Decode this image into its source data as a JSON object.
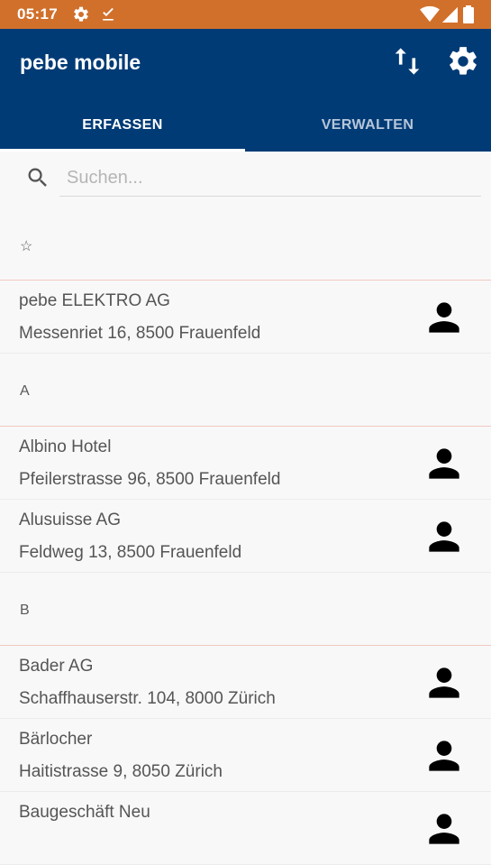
{
  "status_bar": {
    "time": "05:17",
    "icons": [
      "gear-icon",
      "download-done-icon",
      "wifi-icon",
      "signal-icon",
      "battery-icon"
    ]
  },
  "app_bar": {
    "title": "pebe mobile",
    "actions": [
      "sync-arrows-icon",
      "settings-gear-icon"
    ]
  },
  "tabs": [
    {
      "label": "ERFASSEN",
      "active": true
    },
    {
      "label": "VERWALTEN",
      "active": false
    }
  ],
  "search": {
    "placeholder": "Suchen...",
    "value": ""
  },
  "sections": [
    {
      "header": "☆",
      "items": [
        {
          "name": "pebe ELEKTRO AG",
          "address": "Messenriet 16, 8500 Frauenfeld"
        }
      ]
    },
    {
      "header": "A",
      "items": [
        {
          "name": "Albino Hotel",
          "address": "Pfeilerstrasse 96, 8500 Frauenfeld"
        },
        {
          "name": "Alusuisse AG",
          "address": "Feldweg 13, 8500 Frauenfeld"
        }
      ]
    },
    {
      "header": "B",
      "items": [
        {
          "name": "Bader AG",
          "address": "Schaffhauserstr. 104, 8000 Zürich"
        },
        {
          "name": "Bärlocher",
          "address": "Haitistrasse 9, 8050 Zürich"
        },
        {
          "name": "Baugeschäft Neu",
          "address": ""
        }
      ]
    }
  ],
  "colors": {
    "status_bar": "#d1702b",
    "app_bar": "#003b76",
    "section_divider": "#f0c9bd",
    "background": "#f8f8f8"
  }
}
